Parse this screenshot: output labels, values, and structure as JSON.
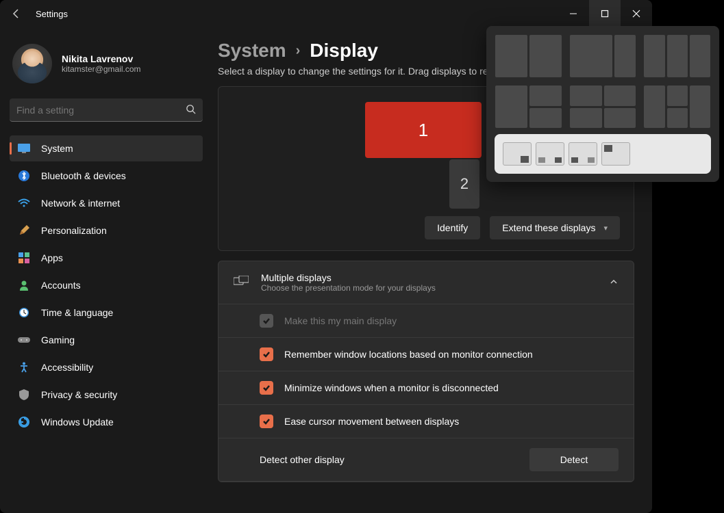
{
  "window": {
    "title": "Settings"
  },
  "profile": {
    "name": "Nikita Lavrenov",
    "email": "kitamster@gmail.com"
  },
  "search": {
    "placeholder": "Find a setting"
  },
  "nav": [
    {
      "label": "System",
      "icon": "monitor"
    },
    {
      "label": "Bluetooth & devices",
      "icon": "bluetooth"
    },
    {
      "label": "Network & internet",
      "icon": "wifi"
    },
    {
      "label": "Personalization",
      "icon": "paint"
    },
    {
      "label": "Apps",
      "icon": "apps"
    },
    {
      "label": "Accounts",
      "icon": "person"
    },
    {
      "label": "Time & language",
      "icon": "clock"
    },
    {
      "label": "Gaming",
      "icon": "gamepad"
    },
    {
      "label": "Accessibility",
      "icon": "accessibility"
    },
    {
      "label": "Privacy & security",
      "icon": "shield"
    },
    {
      "label": "Windows Update",
      "icon": "update"
    }
  ],
  "breadcrumb": {
    "parent": "System",
    "current": "Display"
  },
  "subtitle": "Select a display to change the settings for it. Drag displays to rearrange them.",
  "monitors": {
    "m1": "1",
    "m2": "2"
  },
  "actions": {
    "identify": "Identify",
    "mode": "Extend these displays"
  },
  "panel": {
    "title": "Multiple displays",
    "subtitle": "Choose the presentation mode for your displays",
    "rows": [
      {
        "label": "Make this my main display",
        "checked": true,
        "disabled": true
      },
      {
        "label": "Remember window locations based on monitor connection",
        "checked": true,
        "disabled": false
      },
      {
        "label": "Minimize windows when a monitor is disconnected",
        "checked": true,
        "disabled": false
      },
      {
        "label": "Ease cursor movement between displays",
        "checked": true,
        "disabled": false
      }
    ],
    "detect_label": "Detect other display",
    "detect_btn": "Detect"
  }
}
